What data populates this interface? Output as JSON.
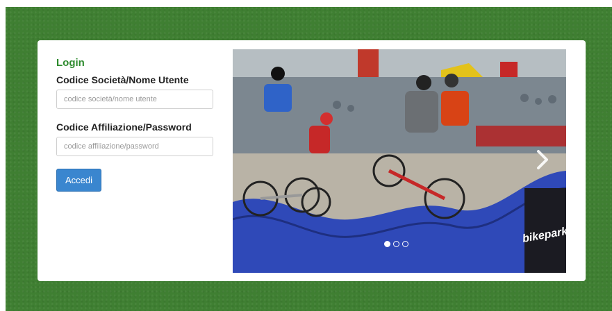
{
  "login": {
    "title": "Login",
    "username_label": "Codice Società/Nome Utente",
    "username_placeholder": "codice società/nome utente",
    "password_label": "Codice Affiliazione/Password",
    "password_placeholder": "codice affiliazione/password",
    "submit_label": "Accedi"
  },
  "carousel": {
    "brand_text": "bikeparklab",
    "slides_total": 3,
    "active_slide": 1,
    "next_icon": "chevron-right-icon"
  },
  "colors": {
    "background_green": "#3f7f32",
    "login_title": "#2e8b2e",
    "button_blue": "#3a86cf",
    "track_blue": "#2f49b8"
  }
}
